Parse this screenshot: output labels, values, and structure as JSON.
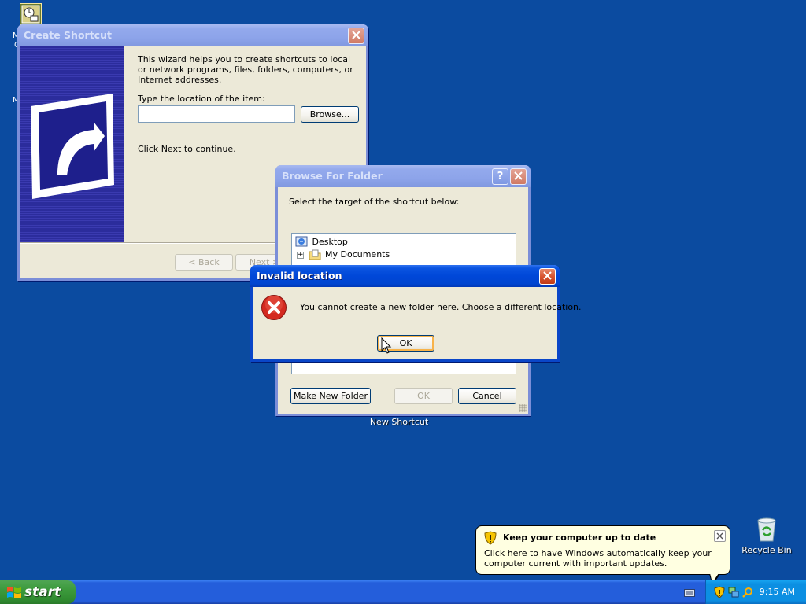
{
  "desktop": {
    "new_shortcut_label": "New Shortcut",
    "recycle_bin_label": "Recycle Bin",
    "left_fragment_1": "M",
    "left_fragment_2": "C",
    "left_fragment_3": "M"
  },
  "create_shortcut": {
    "title": "Create Shortcut",
    "intro": "This wizard helps you to create shortcuts to local or network programs, files, folders, computers, or Internet addresses.",
    "location_label": "Type the location of the item:",
    "location_value": "",
    "browse_button": "Browse...",
    "continue_text": "Click Next to continue.",
    "back_button": "< Back",
    "next_button": "Next >"
  },
  "browse_folder": {
    "title": "Browse For Folder",
    "instruction": "Select the target of the shortcut below:",
    "tree": [
      {
        "label": "Desktop",
        "icon": "desktop-icon"
      },
      {
        "label": "My Documents",
        "icon": "folder-icon"
      }
    ],
    "make_new_folder_button": "Make New Folder",
    "ok_button": "OK",
    "cancel_button": "Cancel"
  },
  "invalid_location": {
    "title": "Invalid location",
    "message": "You cannot create a new folder here.  Choose a different location.",
    "ok_button": "OK",
    "icon": "error-icon"
  },
  "balloon": {
    "title": "Keep your computer up to date",
    "body": "Click here to have Windows automatically keep your computer current with important updates."
  },
  "taskbar": {
    "start_label": "start",
    "clock": "9:15 AM"
  },
  "colors": {
    "desktop": "#0b4ba0",
    "titlebar_active": "#0047d8",
    "titlebar_inactive": "#8da4ea",
    "taskbar": "#245edb",
    "start_green": "#3c9a3c",
    "tray": "#0c8fe2",
    "balloon_bg": "#ffffe1"
  }
}
